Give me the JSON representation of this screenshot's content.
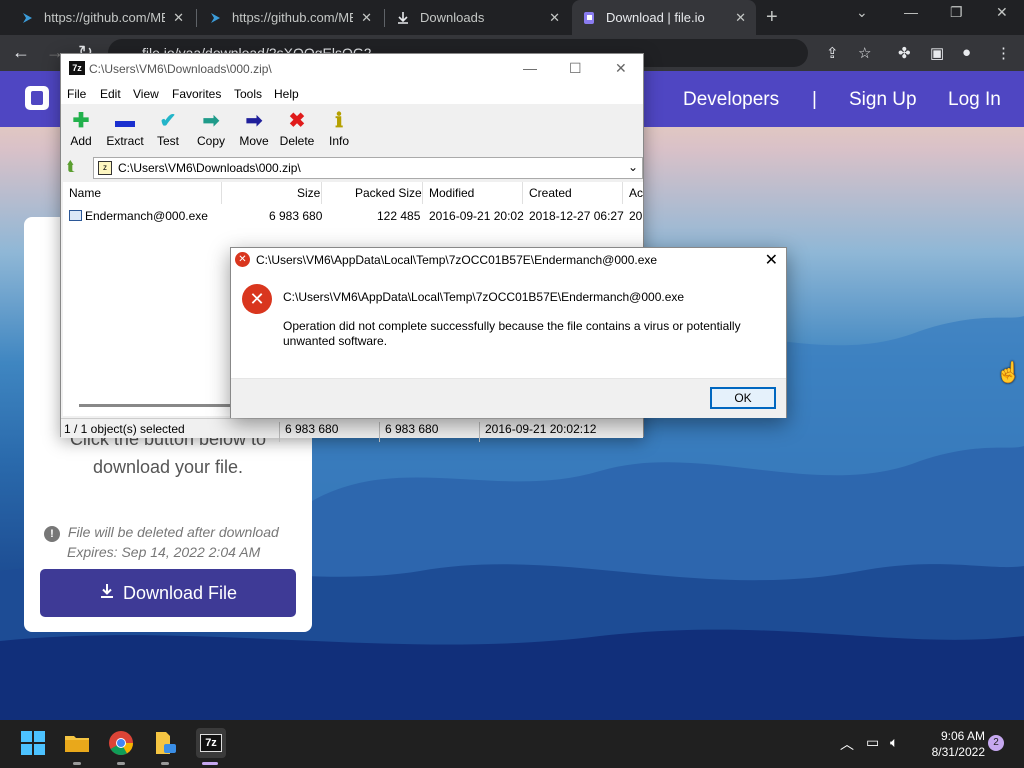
{
  "browser": {
    "tabs": [
      {
        "title": "https://github.com/ME",
        "icon": "vscode-icon",
        "active": false
      },
      {
        "title": "https://github.com/ME",
        "icon": "vscode-icon",
        "active": false
      },
      {
        "title": "Downloads",
        "icon": "download-icon",
        "active": false
      },
      {
        "title": "Download | file.io",
        "icon": "fileio-icon",
        "active": true
      }
    ],
    "url": "file.io/yaa/download/2sXOOgElsOG2",
    "close_glyph": "✕",
    "new_tab_glyph": "+"
  },
  "fileio": {
    "nav": {
      "developers": "Developers",
      "divider": "|",
      "signup": "Sign Up",
      "login": "Log In"
    },
    "card_text_line1": "Click the button below to",
    "card_text_line2": "download your file.",
    "note_line1": "File will be deleted after download",
    "note_line2": "Expires: Sep 14, 2022 2:04 AM",
    "download_button": "Download File"
  },
  "sevenzip": {
    "title": "C:\\Users\\VM6\\Downloads\\000.zip\\",
    "app_icon_text": "7z",
    "menu": [
      "File",
      "Edit",
      "View",
      "Favorites",
      "Tools",
      "Help"
    ],
    "tools": [
      {
        "label": "Add",
        "glyph": "✚",
        "color": "#22b14c"
      },
      {
        "label": "Extract",
        "glyph": "▬",
        "color": "#1a2fcf"
      },
      {
        "label": "Test",
        "glyph": "✔",
        "color": "#23b5c9"
      },
      {
        "label": "Copy",
        "glyph": "➡",
        "color": "#1f9b8a"
      },
      {
        "label": "Move",
        "glyph": "➡",
        "color": "#1f1f9b"
      },
      {
        "label": "Delete",
        "glyph": "✖",
        "color": "#e01b1b"
      },
      {
        "label": "Info",
        "glyph": "ℹ",
        "color": "#b5a000"
      }
    ],
    "path": "C:\\Users\\VM6\\Downloads\\000.zip\\",
    "columns": [
      "Name",
      "Size",
      "Packed Size",
      "Modified",
      "Created",
      "Ac"
    ],
    "row": {
      "name": "Endermanch@000.exe",
      "size": "6 983 680",
      "packed": "122 485",
      "modified": "2016-09-21 20:02",
      "created": "2018-12-27 06:27",
      "accessed": "20"
    },
    "status": {
      "selected": "1 / 1 object(s) selected",
      "size": "6 983 680",
      "size2": "6 983 680",
      "date": "2016-09-21 20:02:12"
    }
  },
  "dialog": {
    "title": "C:\\Users\\VM6\\AppData\\Local\\Temp\\7zOCC01B57E\\Endermanch@000.exe",
    "path": "C:\\Users\\VM6\\AppData\\Local\\Temp\\7zOCC01B57E\\Endermanch@000.exe",
    "message": "Operation did not complete successfully because the file contains a virus or potentially unwanted software.",
    "ok": "OK"
  },
  "taskbar": {
    "time": "9:06 AM",
    "date": "8/31/2022",
    "notifications": "2",
    "apps": [
      "start-icon",
      "file-explorer-icon",
      "chrome-icon",
      "files-icon",
      "7zip-icon"
    ]
  }
}
